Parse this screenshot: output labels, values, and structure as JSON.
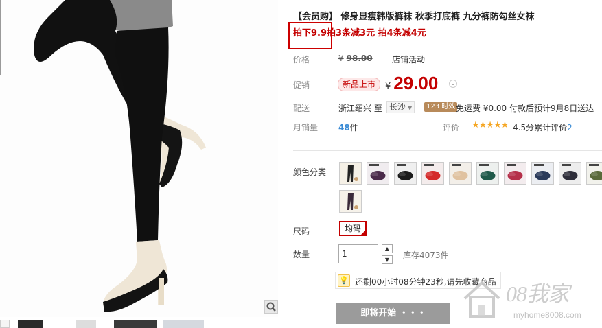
{
  "product": {
    "title": "【会员购】 修身显瘦韩版裤袜 秋季打底裤 九分裤防勾丝女袜",
    "promo_highlight": "拍下9.9",
    "promo_rest": "拍3条减3元 拍4条减4元"
  },
  "price": {
    "label": "价格",
    "currency": "¥",
    "original": "98.00",
    "shop_activity": "店铺活动"
  },
  "promotion": {
    "label": "促销",
    "badge": "新品上市",
    "currency": "¥",
    "price": "29.00"
  },
  "shipping": {
    "label": "配送",
    "from": "浙江绍兴 至",
    "destination": "长沙",
    "timely_badge": "123 时效",
    "fee_text": "免运费 ¥0.00 付款后预计9月8日送达"
  },
  "sales": {
    "label": "月销量",
    "count": "48",
    "unit": "件",
    "review_label": "评价",
    "stars": "★★★★★",
    "rating_text": "4.5分",
    "review_prefix": "累计评价",
    "review_count": "2"
  },
  "sku": {
    "color_label": "颜色分类",
    "colors": [
      {
        "name": "swatch-legging-photo",
        "bg": "#f5f0e6",
        "fg": "#222222"
      },
      {
        "name": "swatch-purple",
        "bg": "#f0ecef",
        "fg": "#4a2a4a"
      },
      {
        "name": "swatch-black",
        "bg": "#efefef",
        "fg": "#1b1b1b"
      },
      {
        "name": "swatch-red",
        "bg": "#f4ecec",
        "fg": "#d42a2a"
      },
      {
        "name": "swatch-nude",
        "bg": "#f3efe9",
        "fg": "#e0c2a0"
      },
      {
        "name": "swatch-green",
        "bg": "#edf0ee",
        "fg": "#1f5a4a"
      },
      {
        "name": "swatch-rose",
        "bg": "#f3ecee",
        "fg": "#b5304a"
      },
      {
        "name": "swatch-navy",
        "bg": "#eceef2",
        "fg": "#2a3a5a"
      },
      {
        "name": "swatch-charcoal",
        "bg": "#ededed",
        "fg": "#2e2e3a"
      },
      {
        "name": "swatch-olive",
        "bg": "#f2f2ec",
        "fg": "#5a6a3a"
      },
      {
        "name": "swatch-purple-legging-photo",
        "bg": "#f6f2ea",
        "fg": "#3a2a3a"
      }
    ],
    "size_label": "尺码",
    "size_value": "均码",
    "qty_label": "数量",
    "qty_value": "1",
    "stock": "库存4073件"
  },
  "tip": {
    "icon": "lightbulb-icon",
    "text": "还剩00小时08分钟23秒,请先收藏商品"
  },
  "buy_button": "即将开始 ・・・",
  "watermark": {
    "text": "08我家",
    "url": "myhome8008.com"
  },
  "colors": {
    "accent_red": "#c40000",
    "link_blue": "#3a8bd5",
    "star_orange": "#f5a623",
    "button_gray": "#9b9b9b"
  }
}
